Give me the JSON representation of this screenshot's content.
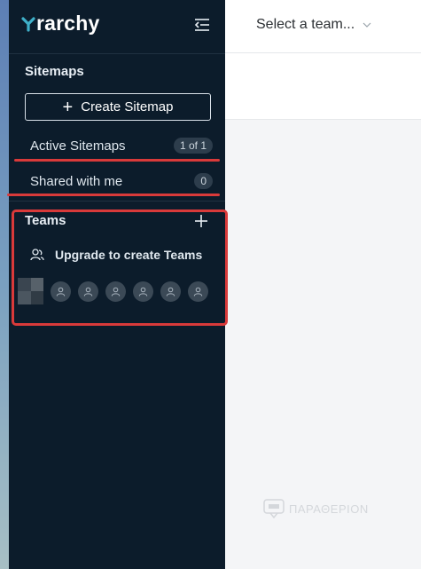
{
  "app": {
    "logo_text": "rarchy"
  },
  "sidebar": {
    "sitemaps_title": "Sitemaps",
    "create_sitemap_label": "Create Sitemap",
    "items": [
      {
        "label": "Active Sitemaps",
        "badge": "1 of 1"
      },
      {
        "label": "Shared with me",
        "badge": "0"
      }
    ],
    "teams_title": "Teams",
    "upgrade_label": "Upgrade to create Teams",
    "member_avatar_count": 6
  },
  "header": {
    "team_select_placeholder": "Select a team..."
  },
  "watermark": {
    "text": "ΠΑΡΑΘΕΡΙΟΝ"
  },
  "colors": {
    "sidebar_bg": "#0c1c2b",
    "annotation_red": "#d93a3a",
    "badge_bg": "#2d3d4c"
  }
}
